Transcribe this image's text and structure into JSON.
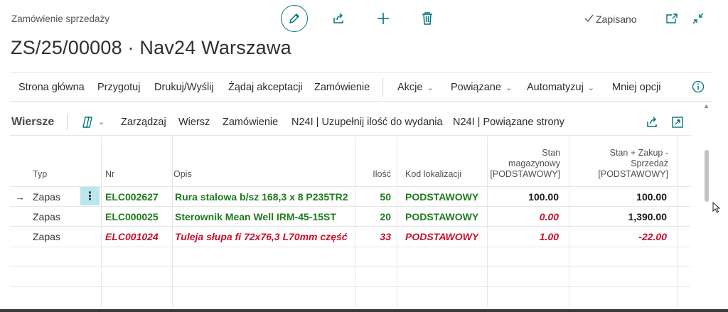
{
  "header": {
    "page_kind": "Zamówienie sprzedaży",
    "title": "ZS/25/00008 · Nav24 Warszawa",
    "saved_label": "Zapisano"
  },
  "actions": [
    {
      "label": "Strona główna",
      "dropdown": false
    },
    {
      "label": "Przygotuj",
      "dropdown": false
    },
    {
      "label": "Drukuj/Wyślij",
      "dropdown": false
    },
    {
      "label": "Żądaj akceptacji",
      "dropdown": false
    },
    {
      "label": "Zamówienie",
      "dropdown": false
    },
    {
      "label": "Akcje",
      "dropdown": true
    },
    {
      "label": "Powiązane",
      "dropdown": true
    },
    {
      "label": "Automatyzuj",
      "dropdown": true
    },
    {
      "label": "Mniej opcji",
      "dropdown": false
    }
  ],
  "lines": {
    "title": "Wiersze",
    "commands": [
      "Zarządzaj",
      "Wiersz",
      "Zamówienie",
      "N24I | Uzupełnij ilość do wydania",
      "N24I | Powiązane strony"
    ]
  },
  "table": {
    "columns": {
      "type": "Typ",
      "no": "Nr",
      "description": "Opis",
      "quantity": "Ilość",
      "location": "Kod lokalizacji",
      "stock": [
        "Stan",
        "magazynowy",
        "[PODSTAWOWY]"
      ],
      "projected": [
        "Stan + Zakup -",
        "Sprzedaż",
        "[PODSTAWOWY]"
      ]
    },
    "rows": [
      {
        "type": "Zapas",
        "no": "ELC002627",
        "description": "Rura stalowa b/sz 168,3 x 8 P235TR2",
        "quantity": "50",
        "location": "PODSTAWOWY",
        "stock": "100.00",
        "projected": "100.00",
        "status": "green"
      },
      {
        "type": "Zapas",
        "no": "ELC000025",
        "description": "Sterownik Mean Well IRM-45-15ST",
        "quantity": "20",
        "location": "PODSTAWOWY",
        "stock": "0.00",
        "projected": "1,390.00",
        "status": "green"
      },
      {
        "type": "Zapas",
        "no": "ELC001024",
        "description": "Tuleja słupa fi 72x76,3 L70mm część",
        "quantity": "33",
        "location": "PODSTAWOWY",
        "stock": "1.00",
        "projected": "-22.00",
        "status": "red"
      }
    ]
  },
  "colors": {
    "accent": "#00737a",
    "ok_green": "#1e7b1e",
    "warn_red": "#c8102e",
    "selected_cell": "#b9e6ef"
  },
  "icons": [
    "edit-icon",
    "share-icon",
    "plus-icon",
    "trash-icon",
    "checkmark-icon",
    "open-window-icon",
    "collapse-icon",
    "info-icon",
    "copilot-icon",
    "expand-icon",
    "arrow-right-icon",
    "more-vertical-icon"
  ]
}
